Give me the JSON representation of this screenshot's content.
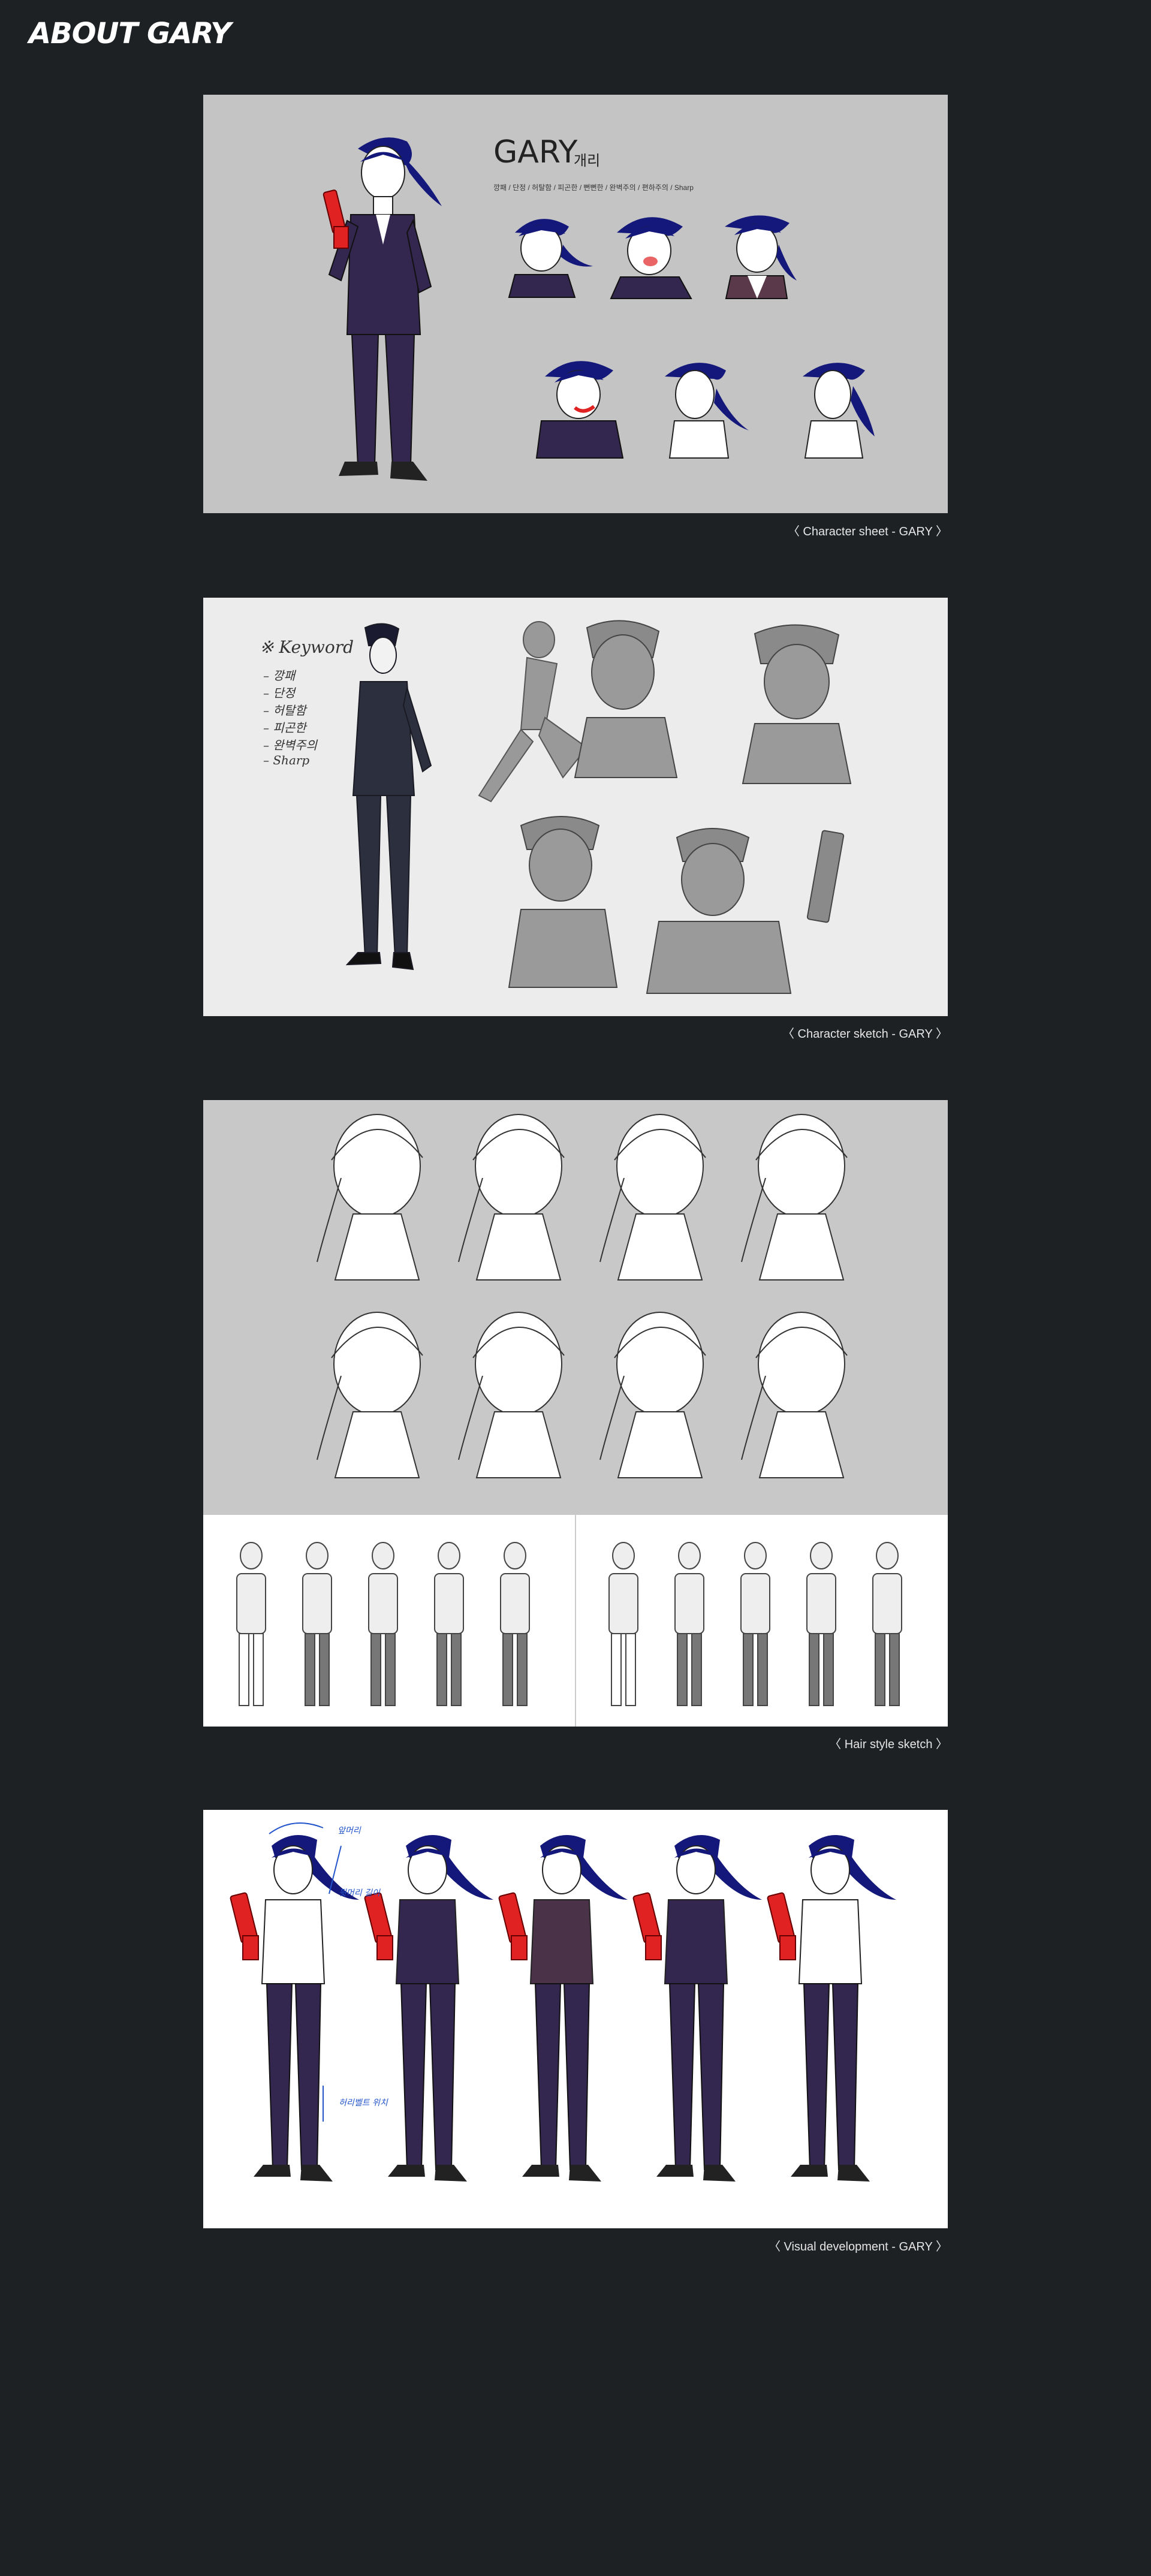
{
  "page": {
    "title": "ABOUT GARY"
  },
  "sheet": {
    "name": "GARY",
    "name_korean": "개리",
    "traits": "깡패 / 단정 / 허탈함 / 피곤한 / 뻔뻔한 / 완벽주의 / 편하주의 / Sharp",
    "caption": "〈 Character sheet - GARY 〉"
  },
  "sketch": {
    "keyword_heading": "※ Keyword",
    "keywords": [
      "깡패",
      "단정",
      "허탈함",
      "피곤한",
      "완벽주의",
      "Sharp"
    ],
    "caption": "〈 Character sketch - GARY 〉"
  },
  "hair": {
    "caption": "〈 Hair style sketch 〉"
  },
  "visdev": {
    "annotations": [
      "앞머리",
      "뒷머리 길이",
      "허리벨트 위치"
    ],
    "caption": "〈 Visual development - GARY 〉"
  },
  "colors": {
    "background": "#1e2124",
    "hair_navy": "#14187a",
    "suit_purple": "#33264f",
    "gun_red": "#e02222",
    "annotation_blue": "#2255cc"
  }
}
